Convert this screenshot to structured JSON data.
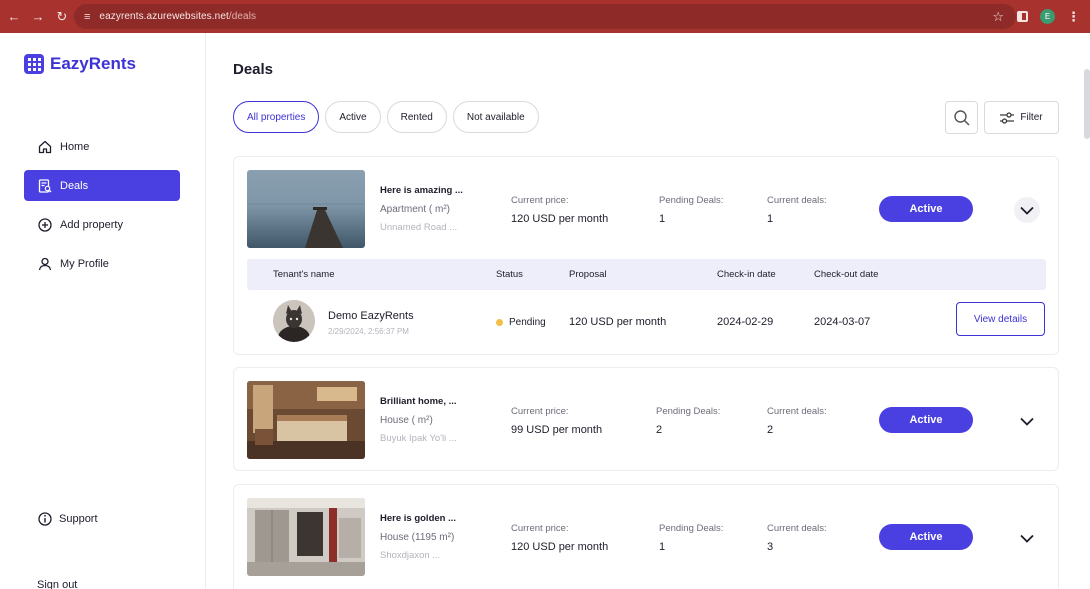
{
  "browser": {
    "url_host": "eazyrents.azurewebsites.net",
    "url_path": "/deals",
    "profile_initial": "E",
    "colors": {
      "frame": "#a8322e",
      "urlbar": "#8e2a27"
    }
  },
  "brand": {
    "name": "EazyRents",
    "color": "#4a3fe0"
  },
  "sidebar": {
    "items": [
      {
        "label": "Home",
        "icon": "home-icon",
        "active": false
      },
      {
        "label": "Deals",
        "icon": "document-search-icon",
        "active": true
      },
      {
        "label": "Add property",
        "icon": "plus-circle-icon",
        "active": false
      },
      {
        "label": "My Profile",
        "icon": "user-icon",
        "active": false
      }
    ],
    "support_label": "Support",
    "cut_item_label": "Sign out"
  },
  "page": {
    "title": "Deals",
    "tabs": [
      {
        "label": "All properties",
        "active": true
      },
      {
        "label": "Active",
        "active": false
      },
      {
        "label": "Rented",
        "active": false
      },
      {
        "label": "Not available",
        "active": false
      }
    ],
    "filter_label": "Filter"
  },
  "labels": {
    "current_price": "Current price:",
    "pending_deals": "Pending Deals:",
    "current_deals": "Current deals:"
  },
  "properties": [
    {
      "title": "Here is amazing ...",
      "type": "Apartment ( m²)",
      "address": "Unnamed Road ...",
      "price": "120 USD per month",
      "pending": "1",
      "current": "1",
      "status": "Active",
      "expanded": true
    },
    {
      "title": "Brilliant home, ...",
      "type": "House ( m²)",
      "address": "Buyuk Ipak Yo'li ...",
      "price": "99 USD per month",
      "pending": "2",
      "current": "2",
      "status": "Active",
      "expanded": false
    },
    {
      "title": "Here is golden ...",
      "type": "House (1195 m²)",
      "address": "Shoxdjaxon ...",
      "price": "120 USD per month",
      "pending": "1",
      "current": "3",
      "status": "Active",
      "expanded": false
    }
  ],
  "deals_table": {
    "headers": [
      "Tenant's name",
      "Status",
      "Proposal",
      "Check-in date",
      "Check-out date"
    ],
    "row": {
      "tenant": "Demo EazyRents",
      "created": "2/29/2024, 2:56:37 PM",
      "status": "Pending",
      "proposal": "120 USD per month",
      "check_in": "2024-02-29",
      "check_out": "2024-03-07",
      "action": "View details"
    }
  }
}
